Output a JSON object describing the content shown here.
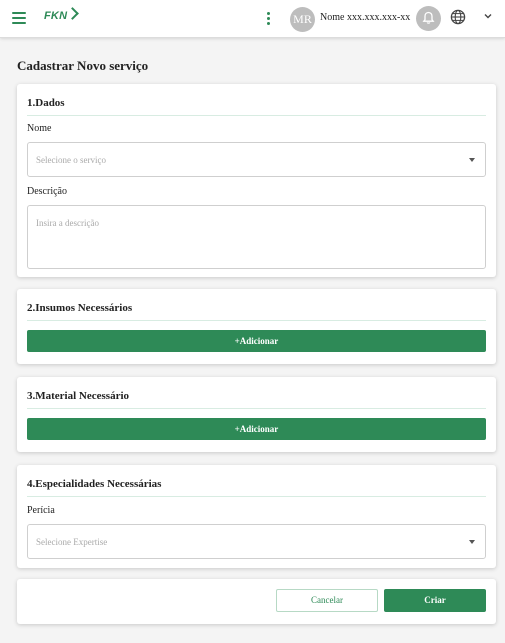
{
  "header": {
    "logo_text": "FKN",
    "avatar_initials": "MR",
    "user_name": "Nome xxx.xxx.xxx-xx"
  },
  "page": {
    "title": "Cadastrar Novo serviço"
  },
  "sections": {
    "dados": {
      "title": "1.Dados",
      "nome_label": "Nome",
      "nome_placeholder": "Selecione o serviço",
      "descricao_label": "Descrição",
      "descricao_placeholder": "Insira a descrição"
    },
    "insumos": {
      "title": "2.Insumos Necessários",
      "add_label": "+Adicionar"
    },
    "material": {
      "title": "3.Material Necessário",
      "add_label": "+Adicionar"
    },
    "especialidades": {
      "title": "4.Especialidades Necessárias",
      "pericia_label": "Perícia",
      "pericia_placeholder": "Selecione Expertise"
    }
  },
  "actions": {
    "cancel_label": "Cancelar",
    "create_label": "Criar"
  },
  "colors": {
    "primary": "#2e8a57",
    "background": "#f4f4f4",
    "avatar": "#bdbdbd"
  },
  "icons": [
    "menu-icon",
    "more-vert-icon",
    "bell-icon",
    "globe-icon",
    "chevron-down-icon",
    "dropdown-arrow-icon"
  ]
}
